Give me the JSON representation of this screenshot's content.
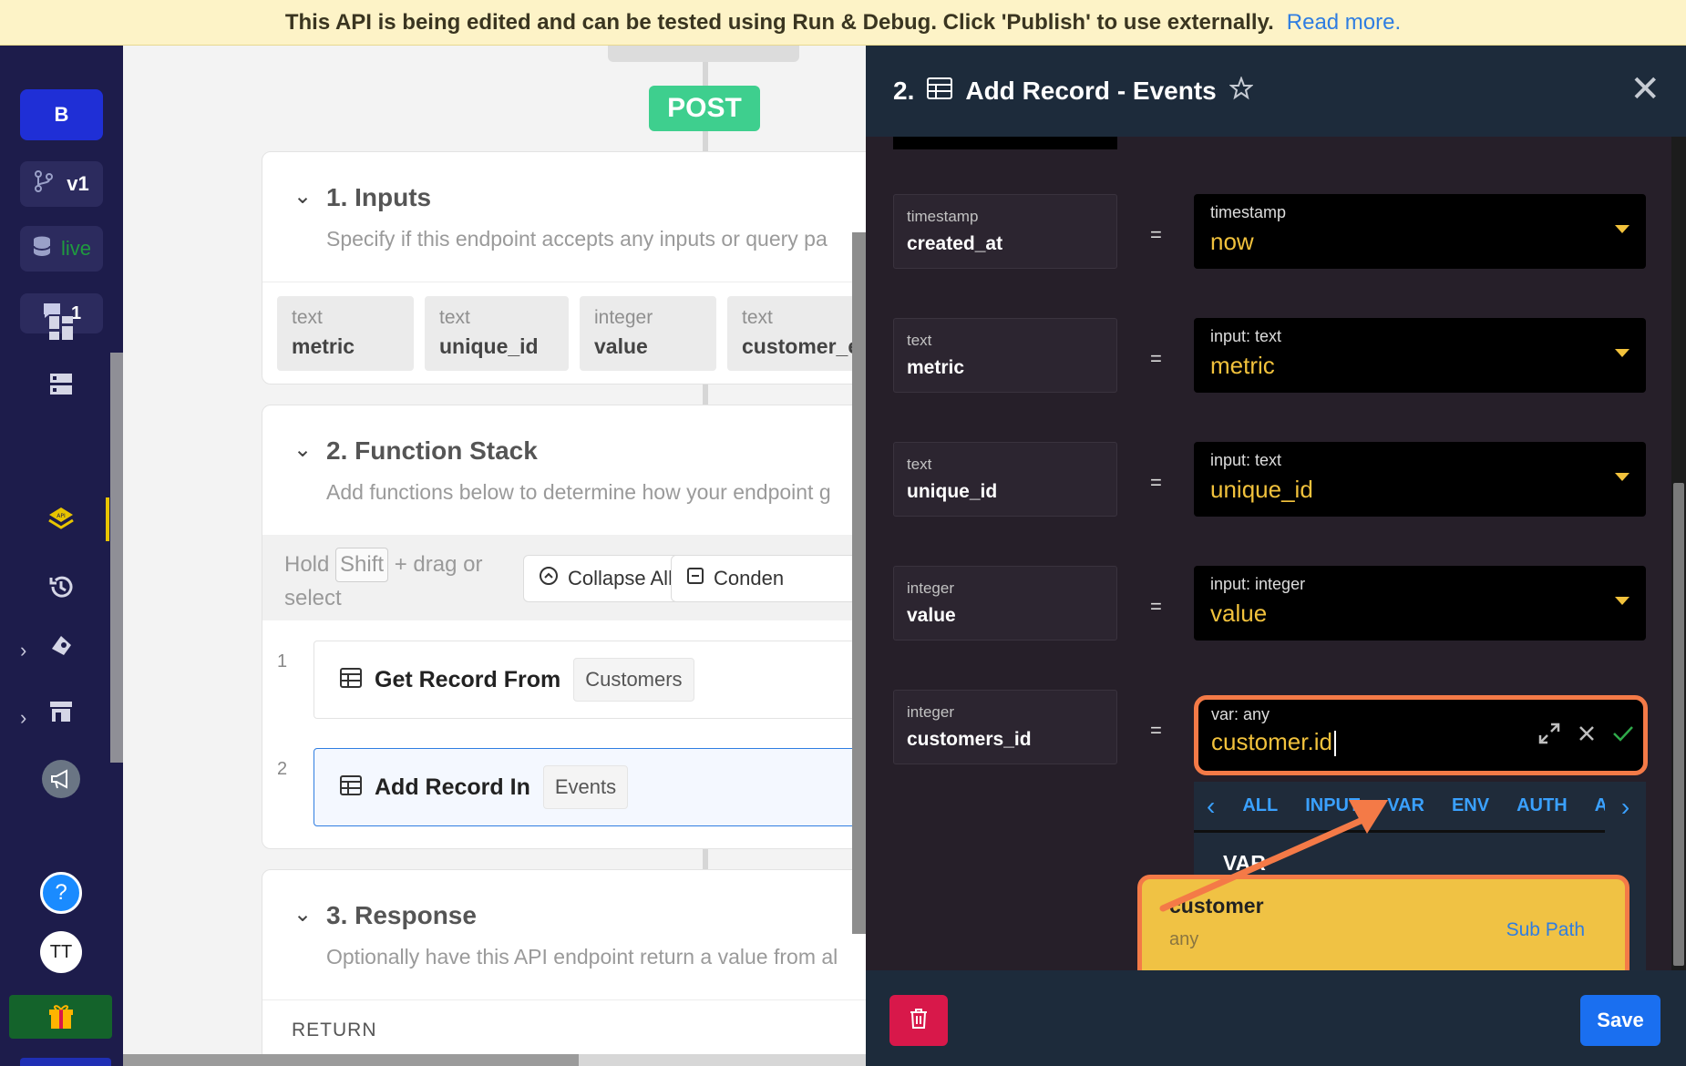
{
  "banner": {
    "message": "This API is being edited and can be tested using Run & Debug. Click 'Publish' to use externally.",
    "link": "Read more."
  },
  "sidebar": {
    "workspace": "B",
    "version": "v1",
    "data_source": "live",
    "comments_count": "1",
    "user_initials": "TT",
    "colors": {
      "bg": "#1d1c4b",
      "active": "#e8c400"
    }
  },
  "canvas": {
    "method": "POST",
    "inputs": {
      "title": "1. Inputs",
      "subtitle": "Specify if this endpoint accepts any inputs or query pa",
      "fields": [
        {
          "type": "text",
          "name": "metric"
        },
        {
          "type": "text",
          "name": "unique_id"
        },
        {
          "type": "integer",
          "name": "value"
        },
        {
          "type": "text",
          "name": "customer_e"
        }
      ]
    },
    "function_stack": {
      "title": "2. Function Stack",
      "subtitle": "Add functions below to determine how your endpoint g",
      "hint_prefix": "Hold",
      "hint_key": "Shift",
      "hint_suffix": "+ drag or select",
      "collapse_all": "Collapse All",
      "condense": "Conden",
      "steps": [
        {
          "num": "1",
          "label": "Get Record From",
          "table": "Customers"
        },
        {
          "num": "2",
          "label": "Add Record In",
          "table": "Events"
        }
      ]
    },
    "response": {
      "title": "3. Response",
      "subtitle": "Optionally have this API endpoint return a value from al",
      "return_label": "RETURN"
    }
  },
  "panel": {
    "step_num": "2.",
    "title": "Add Record - Events",
    "fields": [
      {
        "type": "timestamp",
        "name": "created_at",
        "value_type": "timestamp",
        "value": "now"
      },
      {
        "type": "text",
        "name": "metric",
        "value_type": "input: text",
        "value": "metric"
      },
      {
        "type": "text",
        "name": "unique_id",
        "value_type": "input: text",
        "value": "unique_id"
      },
      {
        "type": "integer",
        "name": "value",
        "value_type": "input: integer",
        "value": "value"
      }
    ],
    "active_field": {
      "type": "integer",
      "name": "customers_id",
      "value_type": "var: any",
      "value": "customer.id"
    },
    "equals": "=",
    "dropdown": {
      "tabs": [
        "ALL",
        "INPUT",
        "VAR",
        "ENV",
        "AUTH",
        "A"
      ],
      "section": "VAR",
      "item": {
        "name": "customer",
        "type": "any",
        "action": "Sub Path"
      }
    },
    "save_label": "Save",
    "colors": {
      "value": "#f2c23c",
      "highlight": "#f47a47",
      "save": "#1a6ff0",
      "delete": "#d8184a"
    }
  }
}
